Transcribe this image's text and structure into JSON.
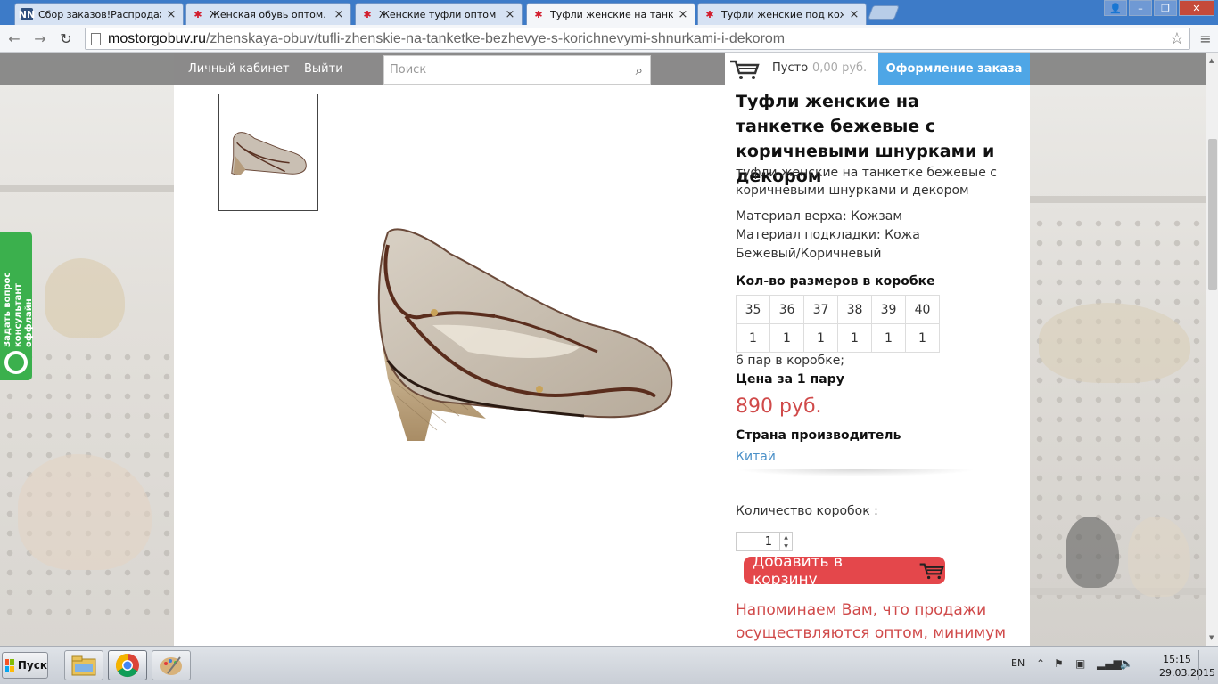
{
  "browser": {
    "tabs": [
      {
        "title": "Сбор заказов!Распродажа дешев",
        "favicon": "nn-icon",
        "active": false
      },
      {
        "title": "Женская обувь оптом. Купить",
        "favicon": "star-icon",
        "active": false
      },
      {
        "title": "Женские туфли оптом | Весь",
        "favicon": "star-icon",
        "active": false
      },
      {
        "title": "Туфли женские на танкетке бежев",
        "favicon": "star-icon",
        "active": true
      },
      {
        "title": "Туфли женские под кожу на",
        "favicon": "star-icon",
        "active": false
      }
    ],
    "url_host": "mostorgobuv.ru",
    "url_path": "/zhenskaya-obuv/tufli-zhenskie-na-tanketke-bezhevye-s-korichnevymi-shnurkami-i-dekorom"
  },
  "site": {
    "nav": {
      "cabinet": "Личный кабинет",
      "logout": "Выйти"
    },
    "search_placeholder": "Поиск",
    "cart": {
      "status": "Пусто",
      "sum": "0,00 руб."
    },
    "checkout_label": "Оформление заказа"
  },
  "product": {
    "title": "Туфли женские на танкетке бежевые с коричневыми шнурками и декором",
    "subtitle": "туфли женские на танкетке бежевые с коричневыми шнурками и декором",
    "material_upper": "Материал верха: Кожзам",
    "material_lining": "Материал подкладки: Кожа",
    "color": "Бежевый/Коричневый",
    "sizes_label": "Кол-во размеров в коробке",
    "sizes": [
      "35",
      "36",
      "37",
      "38",
      "39",
      "40"
    ],
    "counts": [
      "1",
      "1",
      "1",
      "1",
      "1",
      "1"
    ],
    "pairs_in_box": "6 пар в коробке;",
    "price_label": "Цена за 1 пару",
    "price": "890 руб.",
    "country_label": "Страна производитель",
    "country": "Китай",
    "qty_label": "Количество коробок :",
    "qty_value": "1",
    "add_to_cart": "Добавить в корзину",
    "notice": "Напоминаем Вам, что продажи осуществляются оптом, минимум"
  },
  "consultant": {
    "line1": "Задать вопрос",
    "line2": "консультант оффлайн"
  },
  "taskbar": {
    "start_label": "Пуск",
    "lang": "EN",
    "time": "15:15",
    "date": "29.03.2015"
  },
  "colors": {
    "accent_blue": "#4ea6e6",
    "cart_red": "#e4474b",
    "price_red": "#d04a4a",
    "link_blue": "#4a90c8",
    "consult_green": "#3bb04d"
  }
}
